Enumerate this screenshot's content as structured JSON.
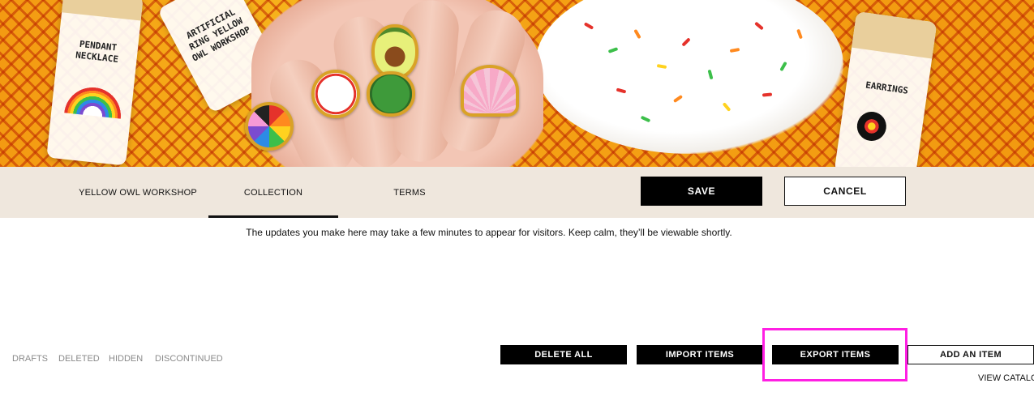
{
  "hero": {
    "tube_left_label": "PENDANT NECKLACE",
    "tube_mid_label": "ARTIFICIAL RING YELLOW OWL WORKSHOP",
    "tube_right_label": "EARRINGS"
  },
  "nav": {
    "tabs": [
      {
        "label": "YELLOW OWL WORKSHOP"
      },
      {
        "label": "COLLECTION"
      },
      {
        "label": "TERMS"
      }
    ],
    "save_label": "SAVE",
    "cancel_label": "CANCEL"
  },
  "notice": "The updates you make here may take a few minutes to appear for visitors. Keep calm, they’ll be viewable shortly.",
  "filters": [
    "DRAFTS",
    "DELETED",
    "HIDDEN",
    "DISCONTINUED"
  ],
  "actions": {
    "delete_all": "DELETE ALL",
    "import_items": "IMPORT ITEMS",
    "export_items": "EXPORT ITEMS",
    "add_item": "ADD AN ITEM",
    "view_catalog": "VIEW CATALOG"
  },
  "colors": {
    "nav_bg": "#efe7dd",
    "highlight": "#ff1fe3",
    "primary_button": "#000000"
  }
}
